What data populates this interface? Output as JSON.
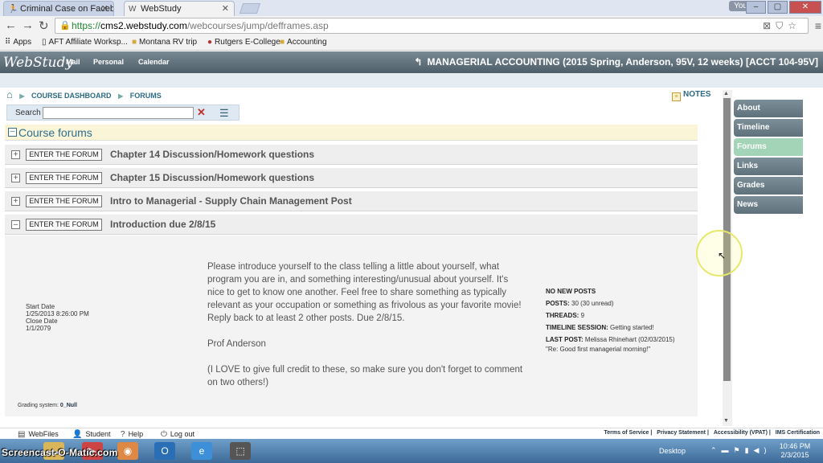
{
  "browser": {
    "tabs": [
      {
        "label": "Criminal Case on Faceboo",
        "icon": "running-figure-icon"
      },
      {
        "label": "WebStudy",
        "icon": "ws-favicon"
      }
    ],
    "user_button": "You",
    "window_buttons": [
      "–",
      "▢",
      "✕"
    ],
    "url": {
      "scheme": "https://",
      "host": "cms2.webstudy.com",
      "path": "/webcourses/jump/defframes.asp"
    },
    "bookmarks": [
      {
        "label": "Apps",
        "icon": "apps-grid-icon"
      },
      {
        "label": "AFT Affiliate Worksp...",
        "icon": "page-icon"
      },
      {
        "label": "Montana RV trip",
        "icon": "folder-icon"
      },
      {
        "label": "Rutgers E-College",
        "icon": "circle-logo-icon"
      },
      {
        "label": "Accounting",
        "icon": "folder-icon"
      }
    ]
  },
  "app": {
    "logo": "WebStudy",
    "nav": [
      "Mail",
      "Personal",
      "Calendar"
    ],
    "course_title": "MANAGERIAL ACCOUNTING (2015 Spring, Anderson, 95V, 12 weeks) [ACCT 104-95V]"
  },
  "breadcrumb": [
    "COURSE DASHBOARD",
    "FORUMS"
  ],
  "notes_label": "NOTES",
  "search": {
    "label": "Search",
    "value": "",
    "placeholder": ""
  },
  "forums": {
    "header": "Course forums",
    "enter_label": "ENTER THE FORUM",
    "rows": [
      {
        "title": "Chapter 14 Discussion/Homework questions",
        "toggle": "+"
      },
      {
        "title": "Chapter 15 Discussion/Homework questions",
        "toggle": "+"
      },
      {
        "title": "Intro to Managerial - Supply Chain Management Post",
        "toggle": "+"
      },
      {
        "title": "Introduction due 2/8/15",
        "toggle": "–"
      }
    ],
    "expanded": {
      "start_date_label": "Start Date",
      "start_date": "1/25/2013 8:26:00 PM",
      "close_date_label": "Close Date",
      "close_date": "1/1/2079",
      "grading_label": "Grading system:",
      "grading_value": "0_Null",
      "description": [
        "Please introduce yourself to the class telling a little about yourself, what program you are in, and something interesting/unusual about yourself. It's nice to get to know one another.  Feel free to share something as typically relevant as your occupation or something as frivolous as your favorite movie! Reply back to at least 2 other posts. Due 2/8/15.",
        "Prof Anderson",
        "(I LOVE to give full credit to these, so make sure you don't forget to comment on two others!)"
      ],
      "stats": {
        "new_posts": "NO NEW POSTS",
        "posts_label": "POSTS:",
        "posts_value": "30 (30 unread)",
        "threads_label": "THREADS:",
        "threads_value": "9",
        "session_label": "TIMELINE SESSION:",
        "session_value": "Getting started!",
        "last_post_label": "LAST POST:",
        "last_post_value": "Melissa Rhinehart (02/03/2015)",
        "last_post_subject": "\"Re: Good first managerial morning!\""
      }
    }
  },
  "side_menu": [
    {
      "label": "About",
      "active": false
    },
    {
      "label": "Timeline",
      "active": false
    },
    {
      "label": "Forums",
      "active": true
    },
    {
      "label": "Links",
      "active": false
    },
    {
      "label": "Grades",
      "active": false
    },
    {
      "label": "News",
      "active": false
    }
  ],
  "footer": {
    "tools": [
      "WebFiles",
      "Student",
      "Help",
      "Log out"
    ],
    "links": [
      "Terms of Service",
      "Privacy Statement",
      "Accessibility (VPAT)",
      "IMS Certification"
    ]
  },
  "taskbar": {
    "watermark": "Screencast-O-Matic.com",
    "desktop_label": "Desktop",
    "time": "10:46 PM",
    "date": "2/3/2015"
  }
}
